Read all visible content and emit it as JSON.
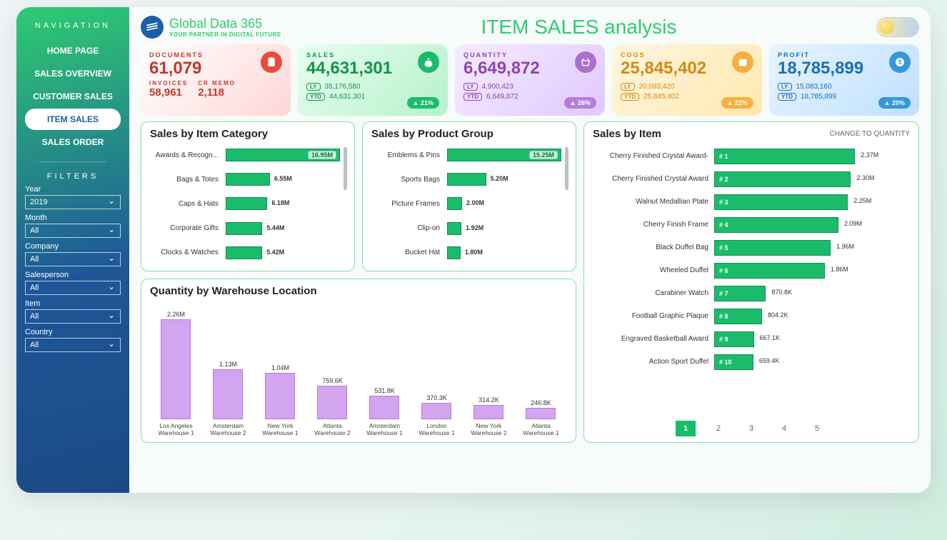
{
  "brand": {
    "name": "Global Data",
    "suffix": "365",
    "tagline": "YOUR PARTNER IN DIGITAL FUTURE"
  },
  "page_title": {
    "strong": "ITEM SALES",
    "light": "analysis"
  },
  "navigation": {
    "title": "NAVIGATION",
    "items": [
      "HOME PAGE",
      "SALES OVERVIEW",
      "CUSTOMER SALES",
      "ITEM SALES",
      "SALES ORDER"
    ],
    "active": "ITEM SALES"
  },
  "filters": {
    "title": "FILTERS",
    "groups": [
      {
        "label": "Year",
        "value": "2019"
      },
      {
        "label": "Month",
        "value": "All"
      },
      {
        "label": "Company",
        "value": "All"
      },
      {
        "label": "Salesperson",
        "value": "All"
      },
      {
        "label": "Item",
        "value": "All"
      },
      {
        "label": "Country",
        "value": "All"
      }
    ]
  },
  "kpis": {
    "documents": {
      "label": "DOCUMENTS",
      "value": "61,079",
      "invoices_label": "INVOICES",
      "invoices": "58,961",
      "crmemo_label": "CR MEMO",
      "crmemo": "2,118"
    },
    "sales": {
      "label": "SALES",
      "value": "44,631,301",
      "ly": "35,176,580",
      "ytd": "44,631,301",
      "pct": "▲ 21%"
    },
    "quantity": {
      "label": "QUANTITY",
      "value": "6,649,872",
      "ly": "4,900,423",
      "ytd": "6,649,872",
      "pct": "▲ 26%"
    },
    "cogs": {
      "label": "COGS",
      "value": "25,845,402",
      "ly": "20,093,420",
      "ytd": "25,845,402",
      "pct": "▲ 22%"
    },
    "profit": {
      "label": "PROFIT",
      "value": "18,785,899",
      "ly": "15,083,160",
      "ytd": "18,785,899",
      "pct": "▲ 20%"
    }
  },
  "panels": {
    "category": {
      "title": "Sales by Item Category"
    },
    "group": {
      "title": "Sales by Product Group"
    },
    "warehouse": {
      "title": "Quantity by Warehouse Location"
    },
    "items": {
      "title": "Sales by Item",
      "action": "CHANGE TO QUANTITY"
    }
  },
  "pager": {
    "pages": [
      "1",
      "2",
      "3",
      "4",
      "5"
    ],
    "active": "1"
  },
  "chart_data": [
    {
      "id": "sales_by_item_category",
      "type": "bar",
      "orientation": "horizontal",
      "title": "Sales by Item Category",
      "unit": "M (Sales $)",
      "categories": [
        "Awards & Recogn...",
        "Bags & Totes",
        "Caps & Hats",
        "Corporate Gifts",
        "Clocks & Watches"
      ],
      "values": [
        16.95,
        6.55,
        6.18,
        5.44,
        5.42
      ],
      "value_labels": [
        "16.95M",
        "6.55M",
        "6.18M",
        "5.44M",
        "5.42M"
      ],
      "label_inside": [
        true,
        false,
        false,
        false,
        false
      ],
      "max": 16.95
    },
    {
      "id": "sales_by_product_group",
      "type": "bar",
      "orientation": "horizontal",
      "title": "Sales by Product Group",
      "unit": "M (Sales $)",
      "categories": [
        "Emblems & Pins",
        "Sports Bags",
        "Picture Frames",
        "Clip-on",
        "Bucket Hat"
      ],
      "values": [
        15.25,
        5.2,
        2.0,
        1.92,
        1.8
      ],
      "value_labels": [
        "15.25M",
        "5.20M",
        "2.00M",
        "1.92M",
        "1.80M"
      ],
      "label_inside": [
        true,
        false,
        false,
        false,
        false
      ],
      "max": 15.25
    },
    {
      "id": "quantity_by_warehouse",
      "type": "bar",
      "orientation": "vertical",
      "title": "Quantity by Warehouse Location",
      "unit": "Quantity",
      "categories": [
        "Los Angeles Warehouse 1",
        "Amsterdam Warehouse 2",
        "New York Warehouse 1",
        "Atlanta Warehouse 2",
        "Amsterdam Warehouse 1",
        "London Warehouse 1",
        "New York Warehouse 2",
        "Atlanta Warehouse 1"
      ],
      "values": [
        2260000,
        1130000,
        1040000,
        759600,
        531800,
        370300,
        314200,
        246800
      ],
      "value_labels": [
        "2.26M",
        "1.13M",
        "1.04M",
        "759.6K",
        "531.8K",
        "370.3K",
        "314.2K",
        "246.8K"
      ],
      "max": 2260000
    },
    {
      "id": "sales_by_item",
      "type": "bar",
      "orientation": "horizontal",
      "title": "Sales by Item",
      "unit": "Sales $",
      "categories": [
        "Cherry Finished Crystal Award-",
        "Cherry Finished Crystal Award",
        "Walnut Medallian Plate",
        "Cherry Finish Frame",
        "Black Duffel Bag",
        "Wheeled Duffel",
        "Carabiner Watch",
        "Football Graphic Plaque",
        "Engraved Basketball Award",
        "Action Sport Duffel"
      ],
      "ranks": [
        "# 1",
        "# 2",
        "# 3",
        "# 4",
        "# 5",
        "# 6",
        "# 7",
        "# 8",
        "# 9",
        "# 10"
      ],
      "values": [
        2370000,
        2300000,
        2250000,
        2090000,
        1960000,
        1860000,
        870800,
        804200,
        667100,
        659400
      ],
      "value_labels": [
        "2.37M",
        "2.30M",
        "2.25M",
        "2.09M",
        "1.96M",
        "1.86M",
        "870.8K",
        "804.2K",
        "667.1K",
        "659.4K"
      ],
      "max": 2370000
    }
  ]
}
